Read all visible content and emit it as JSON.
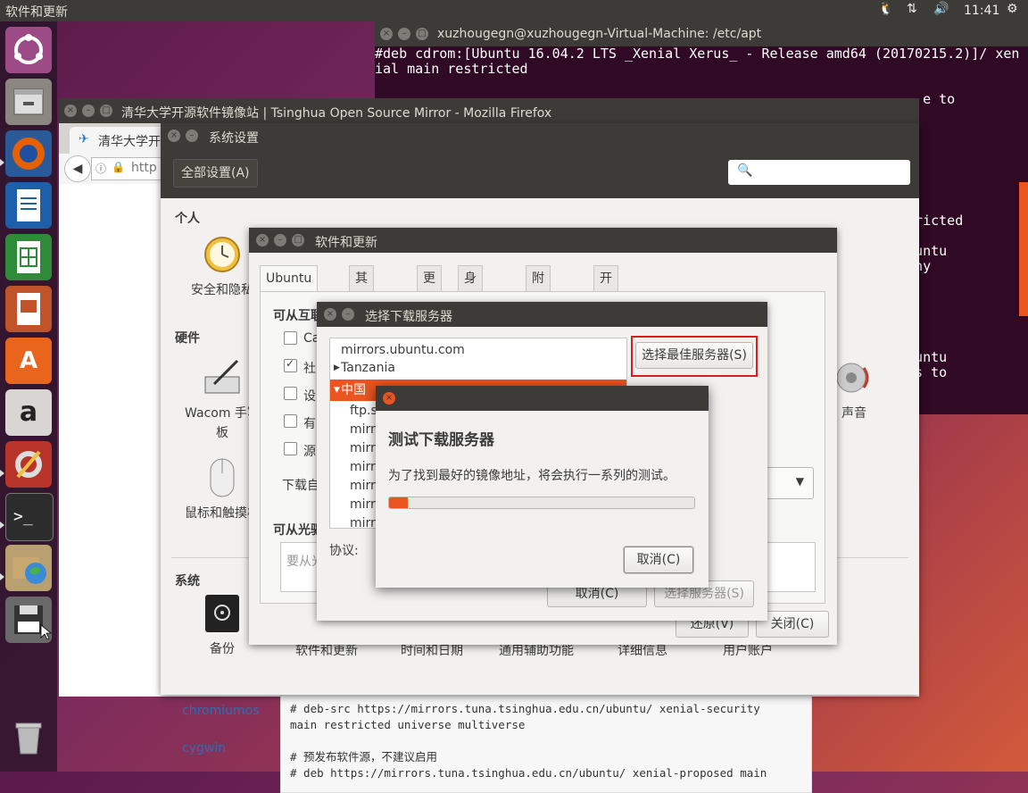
{
  "top_panel": {
    "app_title": "软件和更新",
    "clock": "11:41"
  },
  "terminal": {
    "title": "xuzhougegn@xuzhougegn-Virtual-Machine: /etc/apt",
    "lines": [
      "#deb cdrom:[Ubuntu 16.04.2 LTS _Xenial Xerus_ - Release amd64 (20170215.2)]/ xen",
      "ial main restricted",
      "",
      "                                                                    e to",
      "",
      "",
      "",
      "",
      "",
      "",
      "                                                                 ed",
      "                                                                 stricted",
      "",
      "                                                                 Ubuntu",
      "                                                                  any",
      "",
      "",
      "",
      "                                                                 e",
      "",
      "                                                                 Ubuntu",
      "                                                                  as to"
    ]
  },
  "firefox": {
    "title": "清华大学开源软件镜像站 | Tsinghua Open Source Mirror - Mozilla Firefox",
    "tab_label": "清华大学开",
    "url_partial": "http",
    "sidebar_links": [
      "chromiumos",
      "cygwin"
    ],
    "code_lines": [
      "# deb-src https://mirrors.tuna.tsinghua.edu.cn/ubuntu/ xenial-security",
      "main restricted universe multiverse",
      "",
      "# 预发布软件源，不建议启用",
      "# deb https://mirrors.tuna.tsinghua.edu.cn/ubuntu/ xenial-proposed main"
    ]
  },
  "settings": {
    "title": "系统设置",
    "all_settings": "全部设置(A)",
    "categories": {
      "personal": "个人",
      "hardware": "硬件",
      "system": "系统"
    },
    "personal_items": [
      "安全和隐私"
    ],
    "hardware_items": [
      "Wacom 手写板",
      "鼠标和触摸板",
      "声音"
    ],
    "system_items": [
      "备份",
      "软件和更新",
      "时间和日期",
      "通用辅助功能",
      "详细信息",
      "用户账户"
    ]
  },
  "software_updates": {
    "title": "软件和更新",
    "tabs": [
      "Ubuntu 软件",
      "其它软件",
      "更新",
      "身份验证",
      "附加驱动",
      "开发者选项"
    ],
    "section_internet": "可从互联网下载",
    "checkbox_labels": [
      "Ca",
      "社",
      "设",
      "有",
      "源"
    ],
    "download_from": "下载自",
    "section_cdrom": "可从光驱",
    "cdrom_placeholder": "要从光",
    "revert": "还原(V)",
    "close": "关闭(C)"
  },
  "choose_server": {
    "title": "选择下载服务器",
    "servers": [
      "mirrors.ubuntu.com",
      "Tanzania",
      "中国",
      "ftp.s",
      "mirr",
      "mirr",
      "mirr",
      "mirr",
      "mirr",
      "mirr"
    ],
    "best_server": "选择最佳服务器(S)",
    "protocol_label": "协议:",
    "cancel": "取消(C)",
    "choose": "选择服务器(S)"
  },
  "test_dialog": {
    "heading": "测试下载服务器",
    "message": "为了找到最好的镜像地址，将会执行一系列的测试。",
    "progress": 0.06,
    "cancel": "取消(C)"
  },
  "colors": {
    "accent": "#e95420",
    "highlight_border": "#e01b1b",
    "terminal_bg": "#300a24",
    "link": "#2a6fb5"
  }
}
